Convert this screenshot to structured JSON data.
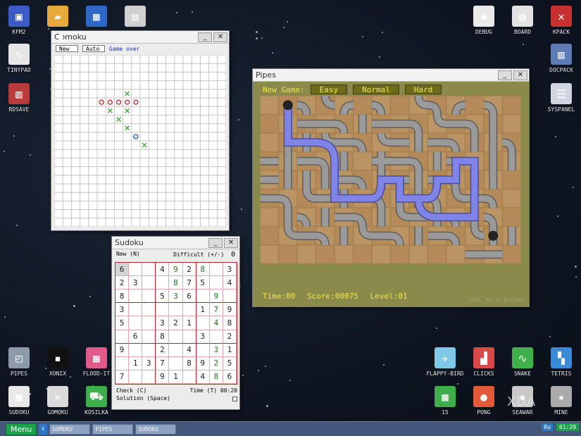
{
  "desktop_icons": [
    {
      "label": "KFM2",
      "icon": "floppy-disk-icon",
      "color": "#3d5bc6"
    },
    {
      "label": "",
      "icon": "folder-icon",
      "color": "#e6a93a"
    },
    {
      "label": "",
      "icon": "app-icon",
      "color": "#2f68c9"
    },
    {
      "label": "",
      "icon": "calculator-icon",
      "color": "#d0d0d0"
    },
    {
      "label": "TINYPAD",
      "icon": "notepad-icon",
      "color": "#e6e6e6"
    },
    {
      "label": "RDSAVE",
      "icon": "ram-save-icon",
      "color": "#b83a3a"
    },
    {
      "label": "DEBUG",
      "icon": "bug-icon",
      "color": "#eaeaea"
    },
    {
      "label": "BOARD",
      "icon": "board-icon",
      "color": "#e2e2e2"
    },
    {
      "label": "KPACK",
      "icon": "wrench-icon",
      "color": "#c83030"
    },
    {
      "label": "DOCPACK",
      "icon": "docpack-icon",
      "color": "#5f7bb5"
    },
    {
      "label": "SYSPANEL",
      "icon": "sliders-icon",
      "color": "#cfd6e2"
    },
    {
      "label": "PIPES",
      "icon": "pipes-icon",
      "color": "#8d9aaa"
    },
    {
      "label": "XONIX",
      "icon": "xonix-icon",
      "color": "#111111"
    },
    {
      "label": "FLOOD-IT",
      "icon": "flood-it-icon",
      "color": "#e25a8a"
    },
    {
      "label": "SUDOKU",
      "icon": "sudoku-icon",
      "color": "#e8e8e8"
    },
    {
      "label": "GOMOKU",
      "icon": "gomoku-icon",
      "color": "#dadada"
    },
    {
      "label": "KOSILKA",
      "icon": "lawnmower-icon",
      "color": "#3fae4a"
    },
    {
      "label": "FLAPPY-BIRD",
      "icon": "bird-icon",
      "color": "#7ec8e8"
    },
    {
      "label": "CLICKS",
      "icon": "clicks-icon",
      "color": "#d84a4a"
    },
    {
      "label": "SNAKE",
      "icon": "snake-icon",
      "color": "#3fb04a"
    },
    {
      "label": "TETRIS",
      "icon": "tetris-icon",
      "color": "#3a8ad8"
    },
    {
      "label": "15",
      "icon": "fifteen-icon",
      "color": "#3fae4a"
    },
    {
      "label": "PONG",
      "icon": "pong-icon",
      "color": "#e25a3a"
    },
    {
      "label": "SEAWAR",
      "icon": "seawar-icon",
      "color": "#c8c8c8"
    },
    {
      "label": "MINE",
      "icon": "mine-icon",
      "color": "#aaaaaa"
    }
  ],
  "gomoku": {
    "title": "Gomoku",
    "new_label": "New",
    "auto_label": "Auto",
    "status": "Game over",
    "grid_size": 20,
    "o_color": "#d22020",
    "x_color": "#2aa02a",
    "last_color": "#2050c8",
    "moves": [
      {
        "col": 5,
        "row": 5,
        "mark": "o"
      },
      {
        "col": 6,
        "row": 5,
        "mark": "o"
      },
      {
        "col": 7,
        "row": 5,
        "mark": "o"
      },
      {
        "col": 8,
        "row": 5,
        "mark": "o"
      },
      {
        "col": 9,
        "row": 5,
        "mark": "o"
      },
      {
        "col": 8,
        "row": 4,
        "mark": "x"
      },
      {
        "col": 6,
        "row": 6,
        "mark": "x"
      },
      {
        "col": 8,
        "row": 6,
        "mark": "x"
      },
      {
        "col": 7,
        "row": 7,
        "mark": "x"
      },
      {
        "col": 8,
        "row": 8,
        "mark": "x"
      },
      {
        "col": 9,
        "row": 9,
        "mark": "o",
        "last": true
      },
      {
        "col": 10,
        "row": 10,
        "mark": "x"
      }
    ]
  },
  "pipes": {
    "title": "Pipes",
    "new_game_label": "New Game:",
    "difficulty_buttons": [
      "Easy",
      "Normal",
      "Hard"
    ],
    "time": "Time:00",
    "score": "Score:00075",
    "level": "Level:01",
    "credit": "2005, Mario Birkner",
    "cols": 14,
    "rows": 9,
    "pipe_color": "#9a9a9a",
    "flow_color": "#7f84e6",
    "tile_color": "#b58e5c"
  },
  "sudoku": {
    "title": "Sudoku",
    "new_label": "New (N)",
    "difficulty_label": "Difficult (+/-)",
    "difficulty_value": "0",
    "check_label": "Check (C)",
    "time_label": "Time (T) 00:20",
    "solution_label": "Solution (Space)",
    "grid": [
      [
        "6",
        "",
        "",
        "4",
        "9",
        "2",
        "8",
        "",
        "3"
      ],
      [
        "2",
        "3",
        "",
        "",
        "8",
        "7",
        "5",
        "",
        "4"
      ],
      [
        "8",
        "",
        "",
        "5",
        "3",
        "6",
        "",
        "9",
        ""
      ],
      [
        "3",
        "",
        "",
        "",
        "",
        "",
        "1",
        "7",
        "9"
      ],
      [
        "5",
        "",
        "",
        "3",
        "2",
        "1",
        "",
        "4",
        "8"
      ],
      [
        "",
        "6",
        "",
        "8",
        "",
        "",
        "3",
        "",
        "2"
      ],
      [
        "9",
        "",
        "",
        "2",
        "",
        "4",
        "",
        "3",
        "1"
      ],
      [
        "",
        "1",
        "3",
        "7",
        "",
        "8",
        "9",
        "2",
        "5"
      ],
      [
        "7",
        "",
        "",
        "9",
        "1",
        "",
        "4",
        "8",
        "6"
      ]
    ],
    "given_mask": [
      [
        1,
        0,
        0,
        1,
        0,
        1,
        0,
        0,
        1
      ],
      [
        1,
        1,
        0,
        0,
        0,
        1,
        1,
        0,
        1
      ],
      [
        1,
        0,
        0,
        1,
        0,
        1,
        0,
        0,
        0
      ],
      [
        1,
        0,
        0,
        0,
        0,
        0,
        1,
        0,
        1
      ],
      [
        1,
        0,
        0,
        1,
        1,
        1,
        0,
        0,
        1
      ],
      [
        0,
        1,
        0,
        1,
        0,
        0,
        1,
        0,
        1
      ],
      [
        1,
        0,
        0,
        1,
        0,
        1,
        0,
        0,
        1
      ],
      [
        0,
        1,
        1,
        1,
        0,
        1,
        1,
        0,
        1
      ],
      [
        1,
        0,
        0,
        1,
        1,
        0,
        1,
        0,
        1
      ]
    ]
  },
  "taskbar": {
    "menu_label": "Menu",
    "tasks": [
      "GOMOKU",
      "PIPES",
      "SUDOKU"
    ],
    "lang": "Ru",
    "clock": "01:29"
  },
  "watermark": "XDA"
}
